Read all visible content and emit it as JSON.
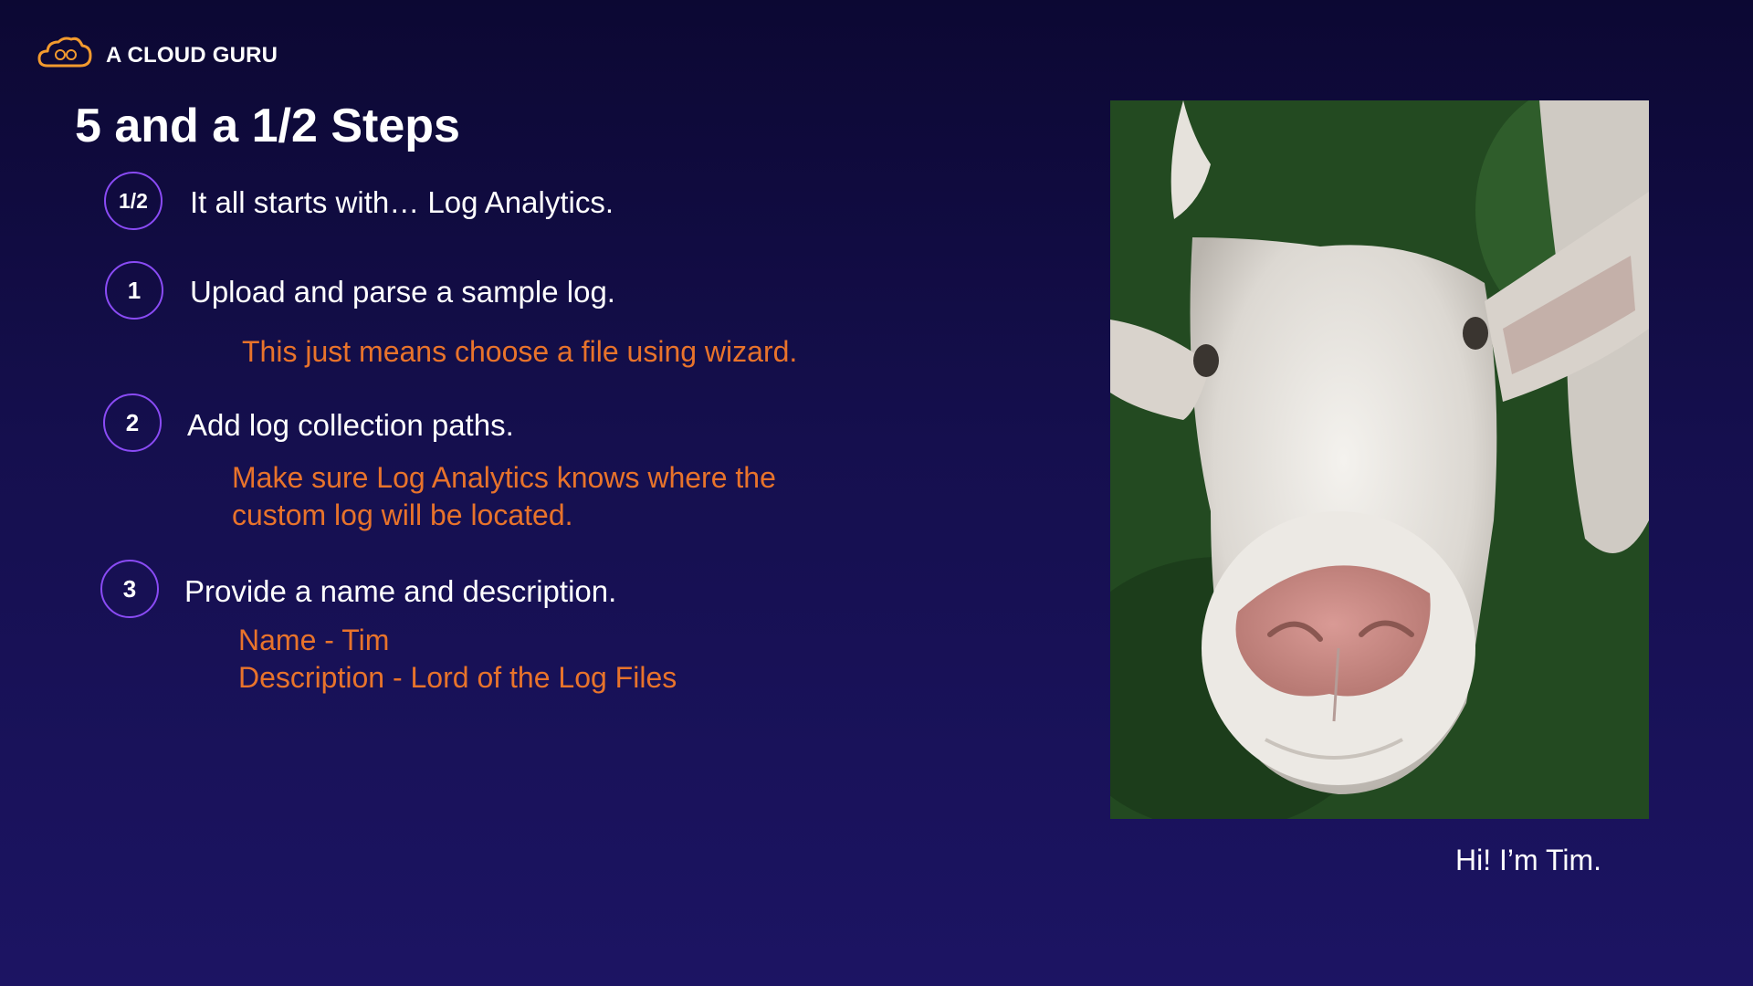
{
  "brand": {
    "name": "A CLOUD GURU",
    "icon": "cloud-logo-icon",
    "color": "#f29a2e"
  },
  "slide": {
    "title": "5 and a 1/2 Steps",
    "steps": [
      {
        "badge": "1/2",
        "text": "It all starts with…   Log Analytics."
      },
      {
        "badge": "1",
        "text": "Upload and parse a sample log.",
        "notes": [
          "This just means choose a file using wizard."
        ]
      },
      {
        "badge": "2",
        "text": "Add log collection paths.",
        "notes": [
          "Make sure Log Analytics knows where the",
          "custom log will be located."
        ]
      },
      {
        "badge": "3",
        "text": "Provide a name and description.",
        "notes": [
          "Name - Tim",
          "Description - Lord of the Log Files"
        ]
      }
    ],
    "caption": "Hi! I’m Tim."
  },
  "colors": {
    "accent": "#e8732b",
    "badge_ring": "#8a4bf5",
    "background": "#150f4e"
  }
}
